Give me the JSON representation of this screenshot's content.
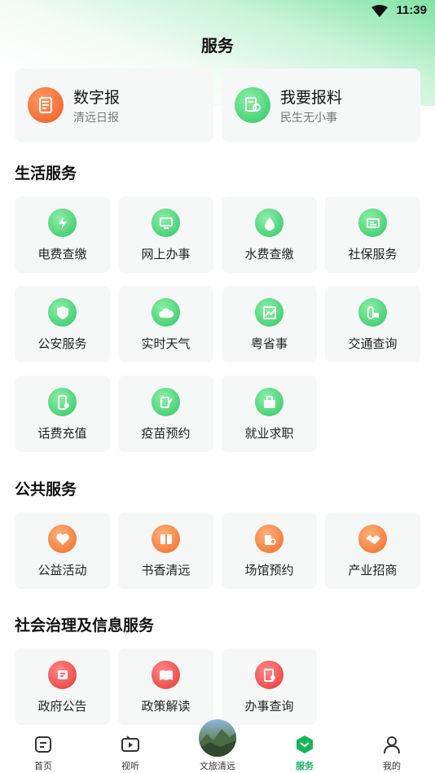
{
  "status": {
    "time": "11:39"
  },
  "page": {
    "title": "服务"
  },
  "featured": [
    {
      "title": "数字报",
      "subtitle": "清远日报",
      "icon": "newspaper-icon"
    },
    {
      "title": "我要报料",
      "subtitle": "民生无小事",
      "icon": "report-icon"
    }
  ],
  "sections": {
    "life": {
      "title": "生活服务",
      "items": [
        {
          "label": "电费查缴",
          "icon": "electricity-icon"
        },
        {
          "label": "网上办事",
          "icon": "computer-icon"
        },
        {
          "label": "水费查缴",
          "icon": "water-icon"
        },
        {
          "label": "社保服务",
          "icon": "id-card-icon"
        },
        {
          "label": "公安服务",
          "icon": "police-badge-icon"
        },
        {
          "label": "实时天气",
          "icon": "cloud-icon"
        },
        {
          "label": "粤省事",
          "icon": "chart-icon"
        },
        {
          "label": "交通查询",
          "icon": "traffic-icon"
        },
        {
          "label": "话费充值",
          "icon": "phone-bill-icon"
        },
        {
          "label": "疫苗预约",
          "icon": "vaccine-icon"
        },
        {
          "label": "就业求职",
          "icon": "briefcase-icon"
        }
      ]
    },
    "public": {
      "title": "公共服务",
      "items": [
        {
          "label": "公益活动",
          "icon": "heart-icon"
        },
        {
          "label": "书香清远",
          "icon": "book-icon"
        },
        {
          "label": "场馆预约",
          "icon": "venue-icon"
        },
        {
          "label": "产业招商",
          "icon": "handshake-icon"
        }
      ]
    },
    "governance": {
      "title": "社会治理及信息服务",
      "items": [
        {
          "label": "政府公告",
          "icon": "announcement-icon"
        },
        {
          "label": "政策解读",
          "icon": "open-book-icon"
        },
        {
          "label": "办事查询",
          "icon": "document-search-icon"
        }
      ]
    }
  },
  "tabbar": [
    {
      "label": "首页",
      "icon": "home-icon",
      "active": false
    },
    {
      "label": "视听",
      "icon": "tv-play-icon",
      "active": false
    },
    {
      "label": "文旅清远",
      "icon": "landscape-avatar",
      "active": false
    },
    {
      "label": "服务",
      "icon": "service-hexagon-icon",
      "active": true
    },
    {
      "label": "我的",
      "icon": "user-icon",
      "active": false
    }
  ],
  "colors": {
    "accent_green": "#1bb35a",
    "orange": "#f06a2a",
    "red": "#e93434",
    "tile_bg": "#f6f8f7"
  }
}
